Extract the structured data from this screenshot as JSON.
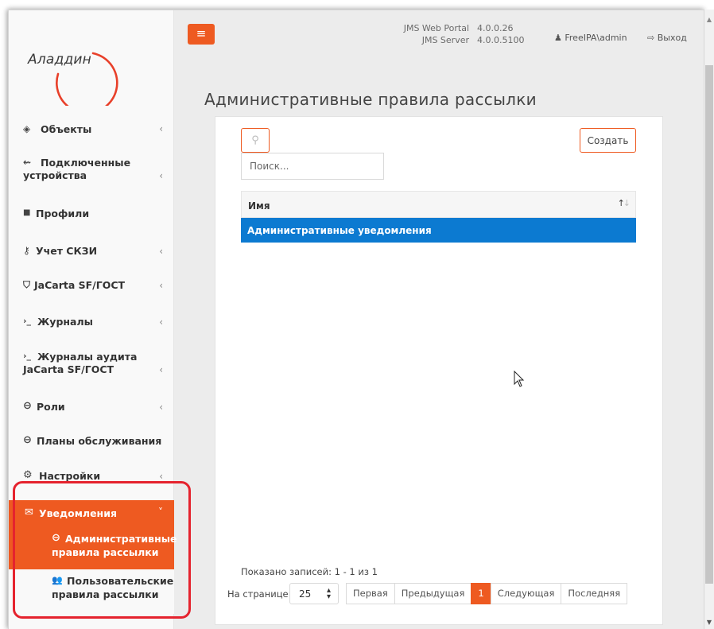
{
  "logo": {
    "text": "Аладдин",
    "color": "#e8402a"
  },
  "sidebar": {
    "items": [
      {
        "icon": "diamond-icon",
        "glyph": "◈",
        "label": "Объекты",
        "chevron": "‹"
      },
      {
        "icon": "usb-icon",
        "glyph": "⇜",
        "label": "Подключенные устройства",
        "chevron": "‹"
      },
      {
        "icon": "folder-icon",
        "glyph": "■",
        "label": "Профили"
      },
      {
        "icon": "key-icon",
        "glyph": "⚷",
        "label": "Учет СКЗИ",
        "chevron": "‹"
      },
      {
        "icon": "shield-icon",
        "glyph": "⛉",
        "label": "JaCarta SF/ГОСТ",
        "chevron": "‹"
      },
      {
        "icon": "terminal-icon",
        "glyph": "›_",
        "label": "Журналы",
        "chevron": "‹"
      },
      {
        "icon": "terminal-icon",
        "glyph": "›_",
        "label": "Журналы аудита JaCarta SF/ГОСТ",
        "chevron": "‹"
      },
      {
        "icon": "user-circle-icon",
        "glyph": "⊖",
        "label": "Роли",
        "chevron": "‹"
      },
      {
        "icon": "user-circle-icon",
        "glyph": "⊖",
        "label": "Планы обслуживания"
      },
      {
        "icon": "gears-icon",
        "glyph": "⚙",
        "label": "Настройки",
        "chevron": "‹"
      },
      {
        "icon": "envelope-icon",
        "glyph": "✉",
        "label": "Уведомления",
        "chevron": "˅"
      }
    ],
    "subitems": [
      {
        "icon": "user-circle-icon",
        "glyph": "⊖",
        "label_line1": "Административные",
        "label_line2": "правила рассылки"
      },
      {
        "icon": "users-icon",
        "glyph": "👥",
        "label_line1": "Пользовательские",
        "label_line2": "правила рассылки"
      }
    ]
  },
  "header": {
    "menu_glyph": "≡",
    "portal_label": "JMS Web Portal",
    "portal_version": "4.0.0.26",
    "server_label": "JMS Server",
    "server_version": "4.0.0.5100",
    "user": "FreeIPA\\admin",
    "user_glyph": "♟",
    "logout": "Выход",
    "logout_glyph": "⇨"
  },
  "page": {
    "title": "Административные правила рассылки"
  },
  "toolbar": {
    "search_glyph": "⚲",
    "search_placeholder": "Поиск...",
    "create_label": "Создать"
  },
  "table": {
    "columns": [
      "Имя"
    ],
    "rows": [
      "Административные уведомления"
    ],
    "selected_color": "#0c7ad1"
  },
  "footer": {
    "records": "Показано записей: 1 - 1 из 1",
    "per_page_label": "На странице:",
    "per_page_value": "25",
    "pager": {
      "first": "Первая",
      "prev": "Предыдущая",
      "current": "1",
      "next": "Следующая",
      "last": "Последняя"
    }
  },
  "colors": {
    "accent": "#ee5a21",
    "highlight_outline": "#e5232e"
  }
}
